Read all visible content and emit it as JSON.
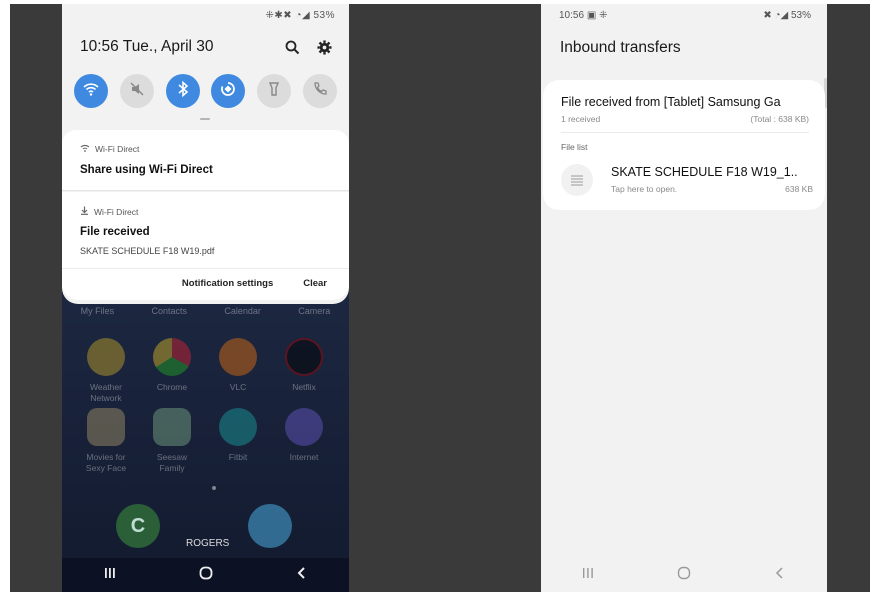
{
  "left": {
    "status_icons": "⁜✱✖ ◔◢ 53%",
    "time": "10:56",
    "date": "Tue., April 30",
    "toggles": [
      {
        "icon": "wifi-icon",
        "on": true
      },
      {
        "icon": "mute-icon",
        "on": false
      },
      {
        "icon": "bluetooth-icon",
        "on": true
      },
      {
        "icon": "auto-rotate-icon",
        "on": true
      },
      {
        "icon": "flashlight-icon",
        "on": false
      },
      {
        "icon": "wifi-calling-icon",
        "on": false
      }
    ],
    "notif1": {
      "app": "Wi-Fi Direct",
      "title": "Share using Wi-Fi Direct"
    },
    "notif2": {
      "app": "Wi-Fi Direct",
      "title": "File received",
      "subtitle": "SKATE SCHEDULE F18 W19.pdf"
    },
    "actions": {
      "settings": "Notification settings",
      "clear": "Clear"
    },
    "home_labels": [
      "My Files",
      "Contacts",
      "Calendar",
      "Camera"
    ],
    "apps_row1": [
      "Weather Network",
      "Chrome",
      "VLC",
      "Netflix"
    ],
    "apps_row2": [
      "Movies for Sexy Face",
      "Seesaw Family",
      "Fitbit",
      "Internet"
    ],
    "carrier": "ROGERS",
    "colors": {
      "accent": "#3f8ae0"
    }
  },
  "right": {
    "time": "10:56",
    "status_left_icons": "▣ ⁜",
    "status_right": "✖ ◔◢ 53%",
    "title": "Inbound transfers",
    "received_title": "File received from [Tablet] Samsung Ga",
    "received_count": "1 received",
    "received_total": "(Total : 638 KB)",
    "file_list_label": "File list",
    "file": {
      "name": "SKATE SCHEDULE F18 W19_1..",
      "hint": "Tap here to open.",
      "size": "638 KB"
    }
  }
}
